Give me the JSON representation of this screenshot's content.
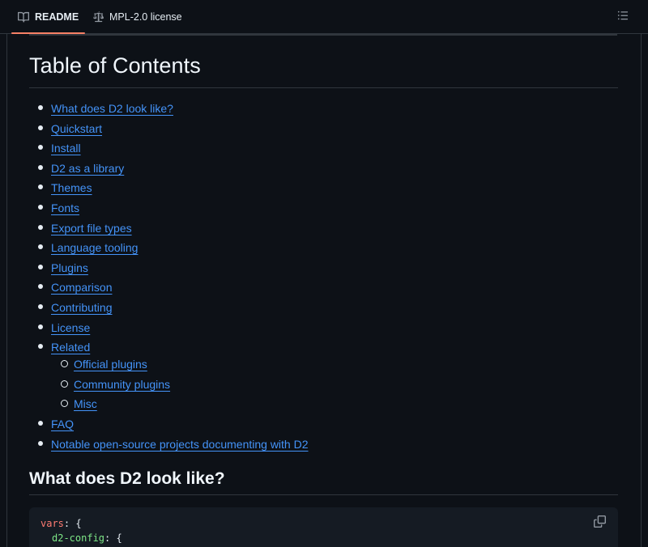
{
  "tabs": [
    {
      "label": "README",
      "icon": "book-icon",
      "active": true
    },
    {
      "label": "MPL-2.0 license",
      "icon": "scale-icon",
      "active": false
    }
  ],
  "outline_icon": "list-unordered-icon",
  "heading": "Table of Contents",
  "toc": [
    "What does D2 look like?",
    "Quickstart",
    "Install",
    "D2 as a library",
    "Themes",
    "Fonts",
    "Export file types",
    "Language tooling",
    "Plugins",
    "Comparison",
    "Contributing",
    "License",
    "Related",
    "FAQ",
    "Notable open-source projects documenting with D2"
  ],
  "toc_related_sub": [
    "Official plugins",
    "Community plugins",
    "Misc"
  ],
  "section_heading": "What does D2 look like?",
  "code": {
    "line1_key": "vars",
    "line1_rest": ": {",
    "line2_key": "d2-config",
    "line2_rest": ": {"
  },
  "colors": {
    "link": "#4493f8",
    "accent": "#f78166",
    "background": "#0d1117"
  }
}
